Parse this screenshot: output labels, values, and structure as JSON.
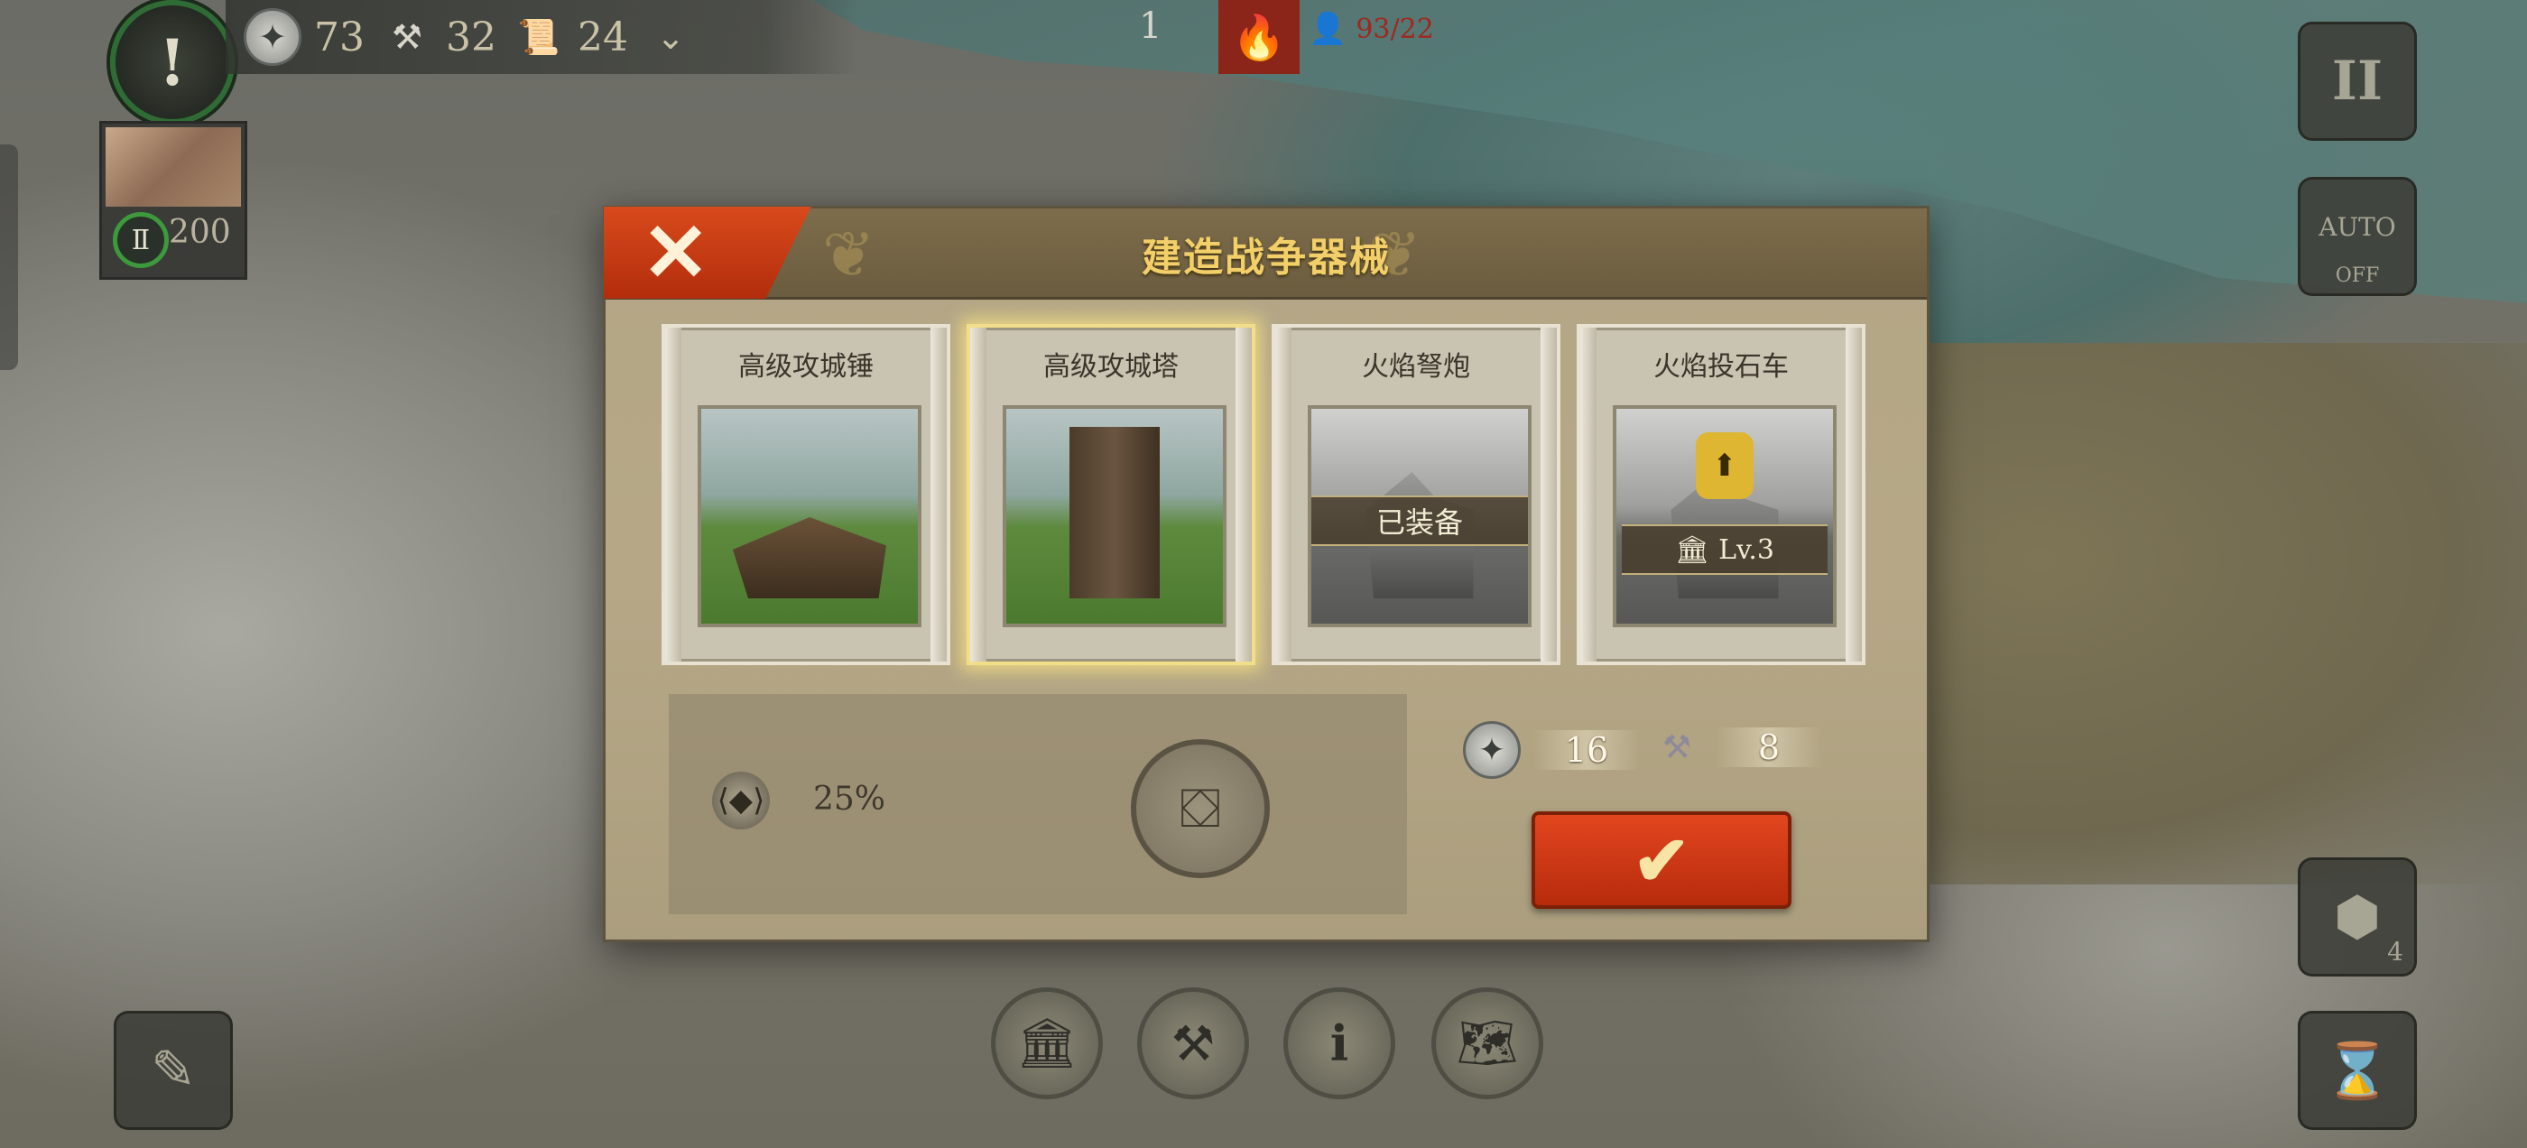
{
  "hud": {
    "silver": "73",
    "hammers": "32",
    "scrolls": "24",
    "alert_symbol": "!",
    "troops": "93/22",
    "top_unit_count": "1"
  },
  "city": {
    "level": "Ⅱ",
    "value": "200"
  },
  "right_buttons": {
    "pause": "II",
    "auto": "AUTO",
    "auto_state": "OFF",
    "hex_count": "4"
  },
  "dialog": {
    "title": "建造战争器械",
    "close_label": "✕",
    "cards": [
      {
        "name": "高级攻城锤",
        "selected": false,
        "state": "",
        "image": "battering-ram"
      },
      {
        "name": "高级攻城塔",
        "selected": true,
        "state": "",
        "image": "siege-tower"
      },
      {
        "name": "火焰弩炮",
        "selected": false,
        "state": "已装备",
        "image": "fire-ballista"
      },
      {
        "name": "火焰投石车",
        "selected": false,
        "state": "Lv.3",
        "image": "fire-catapult"
      }
    ],
    "effect_value": "25%",
    "cost_silver": "16",
    "cost_hammer": "8",
    "confirm_label": "✔"
  },
  "icons": {
    "silver": "eagle-coin-icon",
    "hammer": "hammer-icon",
    "scroll": "scroll-icon",
    "expand": "chevron-down-icon",
    "fire": "fire-icon",
    "person": "person-icon"
  },
  "colors": {
    "title_gold": "#f2cf68",
    "close_red": "#d94a1c",
    "confirm_red": "#e2461f"
  }
}
